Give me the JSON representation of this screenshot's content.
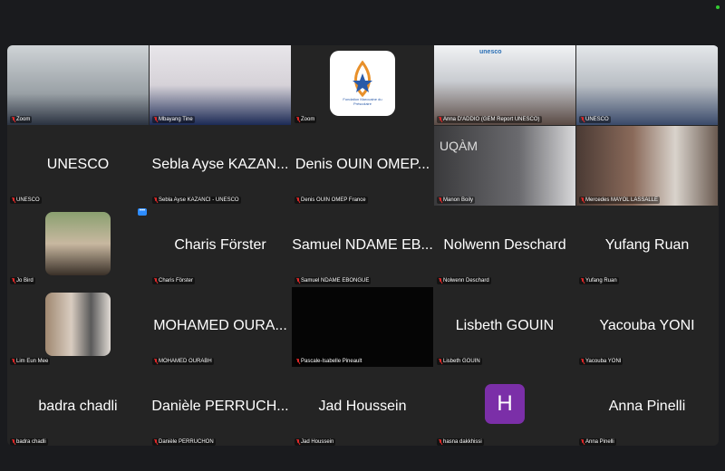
{
  "tiles": [
    {
      "name": "Zoom",
      "kind": "photo",
      "bg": "linear-gradient(180deg,#cfd3d6,#9aa1a6 60%,#2a3240)"
    },
    {
      "name": "Mbayang Tine",
      "kind": "photo",
      "bg": "linear-gradient(180deg,#e8e6ea,#d6d2d8 50%,#1c2a55)"
    },
    {
      "name": "Zoom",
      "kind": "logo",
      "logo_text": "Fondation Marocaine du Préscolaire"
    },
    {
      "name": "Anna D'ADDIO (GEM Report UNESCO)",
      "kind": "photo",
      "bg": "linear-gradient(180deg,#f1f2f4,#c9ccd1 45%,#5a4a44)",
      "active": true,
      "slide_text": "unesco"
    },
    {
      "name": "UNESCO",
      "kind": "photo",
      "bg": "linear-gradient(180deg,#e4e7ea,#b9bec4 50%,#3a4a6a)"
    },
    {
      "name": "UNESCO",
      "display": "UNESCO",
      "kind": "text"
    },
    {
      "name": "Sebla Ayse KAZANCI - UNESCO",
      "display": "Sebla Ayse KAZAN...",
      "kind": "text"
    },
    {
      "name": "Denis OUIN OMEP France",
      "display": "Denis OUIN OMEP...",
      "kind": "text"
    },
    {
      "name": "Manon Boily",
      "kind": "photo",
      "bg": "linear-gradient(90deg,#3a3a3c,#6a6a6e 60%,#d8d8da)",
      "wall_text": "UQÀM"
    },
    {
      "name": "Mercedes MAYOL LASSALLE",
      "kind": "photo",
      "bg": "linear-gradient(90deg,#4a3a34,#8a6a5a 40%,#d9d3cc 70%,#6a5a50)"
    },
    {
      "name": "Jo Bird",
      "kind": "thumb",
      "bg": "linear-gradient(180deg,#8aa070,#c8b8a0 50%,#3a3028)",
      "more": "•••"
    },
    {
      "name": "Charis Förster",
      "display": "Charis Förster",
      "kind": "text"
    },
    {
      "name": "Samuel NDAME EBONGUE",
      "display": "Samuel NDAME EB...",
      "kind": "text"
    },
    {
      "name": "Nolwenn Deschard",
      "display": "Nolwenn Deschard",
      "kind": "text"
    },
    {
      "name": "Yufang Ruan",
      "display": "Yufang Ruan",
      "kind": "text"
    },
    {
      "name": "Lim Eun Mee",
      "kind": "thumb",
      "bg": "linear-gradient(90deg,#a08870,#d8ccc0 40%,#5a5a5a 70%,#e0dad4)"
    },
    {
      "name": "MOHAMED OURABH",
      "display": "MOHAMED OURA...",
      "kind": "text"
    },
    {
      "name": "Pascale-Isabelle Pineault",
      "kind": "photo",
      "bg": "#050505"
    },
    {
      "name": "Lisbeth GOUIN",
      "display": "Lisbeth GOUIN",
      "kind": "text"
    },
    {
      "name": "Yacouba YONI",
      "display": "Yacouba YONI",
      "kind": "text"
    },
    {
      "name": "badra chadli",
      "display": "badra chadli",
      "kind": "text"
    },
    {
      "name": "Danièle PERRUCHON",
      "display": "Danièle PERRUCH...",
      "kind": "text"
    },
    {
      "name": "Jad Houssein",
      "display": "Jad Houssein",
      "kind": "text"
    },
    {
      "name": "hasna dakkhissi",
      "display": "H",
      "kind": "avatar"
    },
    {
      "name": "Anna Pinelli",
      "display": "Anna Pinelli",
      "kind": "text"
    }
  ],
  "colors": {
    "muted": "#e02828",
    "active_border": "#4caf50",
    "avatar": "#7b2fa8"
  }
}
